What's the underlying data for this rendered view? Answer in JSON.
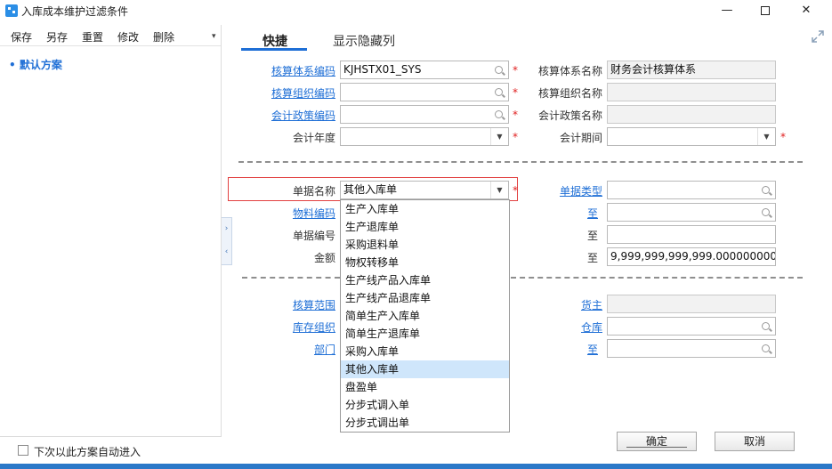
{
  "window": {
    "title": "入库成本维护过滤条件",
    "min": "—",
    "close": "✕"
  },
  "left": {
    "toolbar": [
      "保存",
      "另存",
      "重置",
      "修改",
      "删除"
    ],
    "toolbar_more": "▾",
    "scheme": "默认方案",
    "auto_enter_label": "下次以此方案自动进入",
    "auto_enter_checked": false
  },
  "collapse": {
    "top": "›",
    "bottom": "‹"
  },
  "tabs": {
    "quick": "快捷",
    "hidden_cols": "显示隐藏列"
  },
  "form": {
    "acct_system_code_label": "核算体系编码",
    "acct_system_code_value": "KJHSTX01_SYS",
    "acct_system_name_label": "核算体系名称",
    "acct_system_name_value": "财务会计核算体系",
    "acct_org_code_label": "核算组织编码",
    "acct_org_code_value": "",
    "acct_org_name_label": "核算组织名称",
    "acct_org_name_value": "",
    "policy_code_label": "会计政策编码",
    "policy_code_value": "",
    "policy_name_label": "会计政策名称",
    "policy_name_value": "",
    "year_label": "会计年度",
    "year_value": "",
    "period_label": "会计期间",
    "period_value": "",
    "doc_name_label": "单据名称",
    "doc_name_value": "其他入库单",
    "doc_type_label": "单据类型",
    "doc_type_value": "",
    "material_code_label": "物料编码",
    "to_label": "至",
    "doc_no_label": "单据编号",
    "amount_label": "金额",
    "amount_to_value": "9,999,999,999,999.0000000000",
    "scope_label": "核算范围",
    "owner_label": "货主",
    "stock_org_label": "库存组织",
    "warehouse_label": "仓库",
    "dept_label": "部门",
    "required_mark": "*"
  },
  "dropdown": {
    "items": [
      "生产入库单",
      "生产退库单",
      "采购退料单",
      "物权转移单",
      "生产线产品入库单",
      "生产线产品退库单",
      "简单生产入库单",
      "简单生产退库单",
      "采购入库单",
      "其他入库单",
      "盘盈单",
      "分步式调入单",
      "分步式调出单"
    ],
    "selected_index": 9
  },
  "buttons": {
    "ok": "确定",
    "cancel": "取消"
  },
  "colors": {
    "link": "#1f6fd6",
    "accent": "#1f6fd6",
    "required": "#e02020",
    "selected_row": "#cfe6fb",
    "highlight_border": "#e24040"
  }
}
